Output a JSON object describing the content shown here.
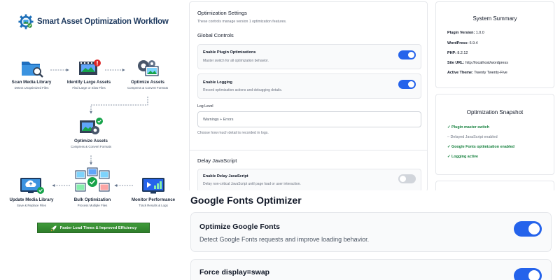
{
  "workflow": {
    "title": "Smart Asset Optimization Workflow",
    "nodes": {
      "scan": {
        "title": "Scan Media Library",
        "subtitle": "Detect Unoptimized Files"
      },
      "identify": {
        "title": "Identify Large Assets",
        "subtitle": "Find Large or Slow Files"
      },
      "optimize_top": {
        "title": "Optimize Assets",
        "subtitle": "Compress & Convert Formats"
      },
      "optimize_mid": {
        "title": "Optimize Assets",
        "subtitle": "Compress & Convert Formats"
      },
      "update": {
        "title": "Update Media Library",
        "subtitle": "Save & Replace Files"
      },
      "bulk": {
        "title": "Bulk Optimization",
        "subtitle": "Process Multiple Files"
      },
      "monitor": {
        "title": "Monitor Performance",
        "subtitle": "Track Results & Logs"
      }
    },
    "cta_label": "Faster Load Times & Improved Efficiency"
  },
  "settings": {
    "title": "Optimization Settings",
    "description": "These controls manage version 1 optimization features.",
    "global_controls": {
      "heading": "Global Controls",
      "plugin_optimizations": {
        "label": "Enable Plugin Optimizations",
        "help": "Master switch for all optimization behavior.",
        "enabled": true
      },
      "logging": {
        "label": "Enable Logging",
        "help": "Record optimization actions and debugging details.",
        "enabled": true
      },
      "log_level": {
        "label": "Log Level",
        "value": "Warnings + Errors",
        "help": "Choose how much detail is recorded in logs."
      }
    },
    "delay_js": {
      "heading": "Delay JavaScript",
      "toggle": {
        "label": "Enable Delay JavaScript",
        "help": "Delay non-critical JavaScript until page load or user interaction.",
        "enabled": false
      }
    }
  },
  "system_summary": {
    "title": "System Summary",
    "rows": [
      {
        "key": "Plugin Version:",
        "value": "1.0.0"
      },
      {
        "key": "WordPress:",
        "value": "6.9.4"
      },
      {
        "key": "PHP:",
        "value": "8.2.12"
      },
      {
        "key": "Site URL:",
        "value": "http://localhost/wordpress"
      },
      {
        "key": "Active Theme:",
        "value": "Twenty Twenty-Five"
      }
    ]
  },
  "snapshot": {
    "title": "Optimization Snapshot",
    "items": [
      {
        "text": "✓ Plugin master switch",
        "status": "ok"
      },
      {
        "text": "– Delayed JavaScript enabled",
        "status": "off"
      },
      {
        "text": "✓ Google Fonts optimization enabled",
        "status": "ok"
      },
      {
        "text": "✓ Logging active",
        "status": "ok"
      }
    ]
  },
  "google_fonts": {
    "title": "Google Fonts Optimizer",
    "optimize": {
      "label": "Optimize Google Fonts",
      "help": "Detect Google Fonts requests and improve loading behavior.",
      "enabled": true
    },
    "display_swap": {
      "label": "Force display=swap",
      "enabled": true
    }
  },
  "colors": {
    "accent": "#2563eb",
    "success": "#15803d",
    "cta": "#2e7d2a",
    "brand_dark": "#1e3a5f"
  }
}
